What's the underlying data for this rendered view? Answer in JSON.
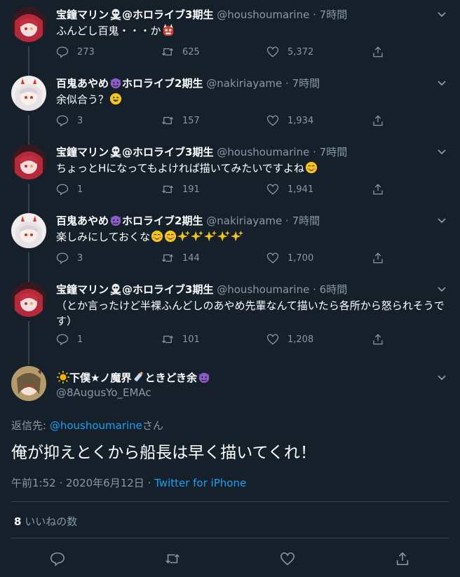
{
  "thread": [
    {
      "name": "宝鐘マリン",
      "name_suffix": "@ホロライブ3期生",
      "handle": "@houshoumarine",
      "time": "· 7時間",
      "text": "ふんどし百鬼・・・か",
      "emoji": [
        "oni-emoji"
      ],
      "reply": "273",
      "retweet": "625",
      "like": "5,372"
    },
    {
      "name": "百鬼あやめ",
      "name_suffix": "ホロライブ2期生",
      "handle": "@nakiriayame",
      "time": "· 7時間",
      "text": "余似合う？",
      "emoji": [
        "smile-emoji"
      ],
      "reply": "3",
      "retweet": "157",
      "like": "1,934"
    },
    {
      "name": "宝鐘マリン",
      "name_suffix": "@ホロライブ3期生",
      "handle": "@houshoumarine",
      "time": "· 7時間",
      "text": "ちょっとHになってもよければ描いてみたいですよね",
      "emoji": [
        "blush-emoji"
      ],
      "reply": "1",
      "retweet": "191",
      "like": "1,941"
    },
    {
      "name": "百鬼あやめ",
      "name_suffix": "ホロライブ2期生",
      "handle": "@nakiriayame",
      "time": "· 7時間",
      "text": "楽しみにしておくな",
      "emoji": [
        "blush-emoji",
        "blush-emoji",
        "sparkles-emoji",
        "sparkles-emoji",
        "sparkles-emoji",
        "sparkles-emoji",
        "sparkles-emoji"
      ],
      "reply": "3",
      "retweet": "144",
      "like": "1,700"
    },
    {
      "name": "宝鐘マリン",
      "name_suffix": "@ホロライブ3期生",
      "handle": "@houshoumarine",
      "time": "· 6時間",
      "text": "（とか言ったけど半裸ふんどしのあやめ先輩なんて描いたら各所から怒られそうです）",
      "emoji": [],
      "reply": "1",
      "retweet": "101",
      "like": "1,208"
    }
  ],
  "main": {
    "name": "下僕★ノ魔界",
    "name_rest": "ときどき余",
    "handle": "@8AugusYo_EMAc",
    "reply_prefix": "返信先: ",
    "reply_to": "@houshoumarine",
    "reply_suffix": "さん",
    "body": "俺が抑えとくから船長は早く描いてくれ！",
    "meta_time": "午前1:52 · 2020年6月12日 · ",
    "meta_source": "Twitter for iPhone",
    "likes_count": "8",
    "likes_label": " いいねの数"
  },
  "colors": {
    "background": "#15202b",
    "muted": "#8899a6",
    "accent": "#1da1f2",
    "divider": "#38444d"
  }
}
